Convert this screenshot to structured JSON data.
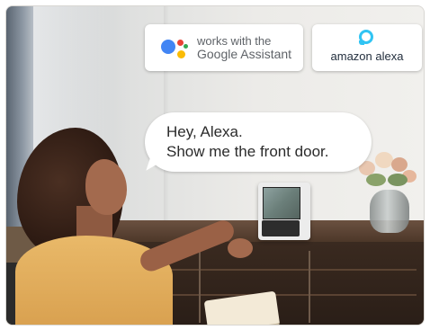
{
  "badges": {
    "google": {
      "line1": "works with the",
      "line2": "Google Assistant"
    },
    "alexa": {
      "label": "amazon alexa"
    }
  },
  "speech": {
    "line1": "Hey, Alexa.",
    "line2": "Show me the front door."
  },
  "colors": {
    "google_blue": "#4285F4",
    "google_red": "#EA4335",
    "google_yellow": "#FBBC05",
    "google_green": "#34A853",
    "alexa_cyan": "#31C4F3"
  },
  "icons": {
    "google": "google-assistant-icon",
    "alexa": "alexa-ring-icon"
  }
}
